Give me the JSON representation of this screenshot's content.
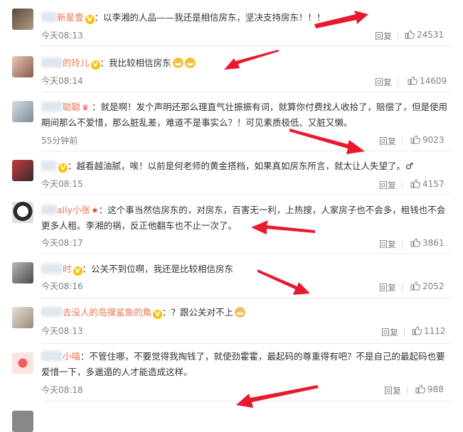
{
  "colors": {
    "accent": "#eb7350",
    "meta": "#808080",
    "arrow": "#e8192c"
  },
  "comments": [
    {
      "name": "新星壹",
      "text": "：以李湘的人品——我还是相信房东，坚决支持房东！！！",
      "time": "今天08:13",
      "reply": "回复",
      "likes": "24531",
      "badge": "v"
    },
    {
      "name": "的玲儿",
      "text": "：我比较相信房东",
      "time": "今天08:14",
      "reply": "回复",
      "likes": "14609",
      "badge": "v"
    },
    {
      "name": "聪聪",
      "text": "：就是啊！发个声明还那么理直气壮振振有词，就算你付费找人收拾了，赔偿了，但是使用期间那么不爱惜，那么脏乱差，难道不是事实么？！可见素质极低、又脏又懒。",
      "time": "55分钟前",
      "reply": "回复",
      "likes": "9023",
      "badge": "crown"
    },
    {
      "name": "",
      "text": "：越看越油腻，唉！以前是何老师的黄金搭档，如果真如房东所言，就太让人失望了。♂",
      "time": "今天08:15",
      "reply": "回复",
      "likes": "4157",
      "badge": "v"
    },
    {
      "name": "ally小张",
      "text": "：这个事当然信房东的，对房东，百害无一利，上热搜，人家房子也不会多，租钱也不会更多人租。李湘的祸，反正他翻车也不止一次了。",
      "time": "今天08:17",
      "reply": "回复",
      "likes": "3861",
      "badge": "star"
    },
    {
      "name": "时",
      "text": "：公关不到位啊，我还是比较相信房东",
      "time": "今天08:16",
      "reply": "回复",
      "likes": "2052",
      "badge": "v"
    },
    {
      "name": "去没人的岛摸鲨鱼的角",
      "text": "：？跟公关对不上",
      "time": "今天08:13",
      "reply": "回复",
      "likes": "1112",
      "badge": "v"
    },
    {
      "name": "小喵",
      "text": "：不管住哪，不要觉得我掏钱了，就使劲霍霍，最起码的尊重得有吧？不是自己的最起码也要爱惜一下，多邋遢的人才能造成这样。",
      "time": "今天08:18",
      "reply": "回复",
      "likes": "988",
      "badge": ""
    }
  ]
}
